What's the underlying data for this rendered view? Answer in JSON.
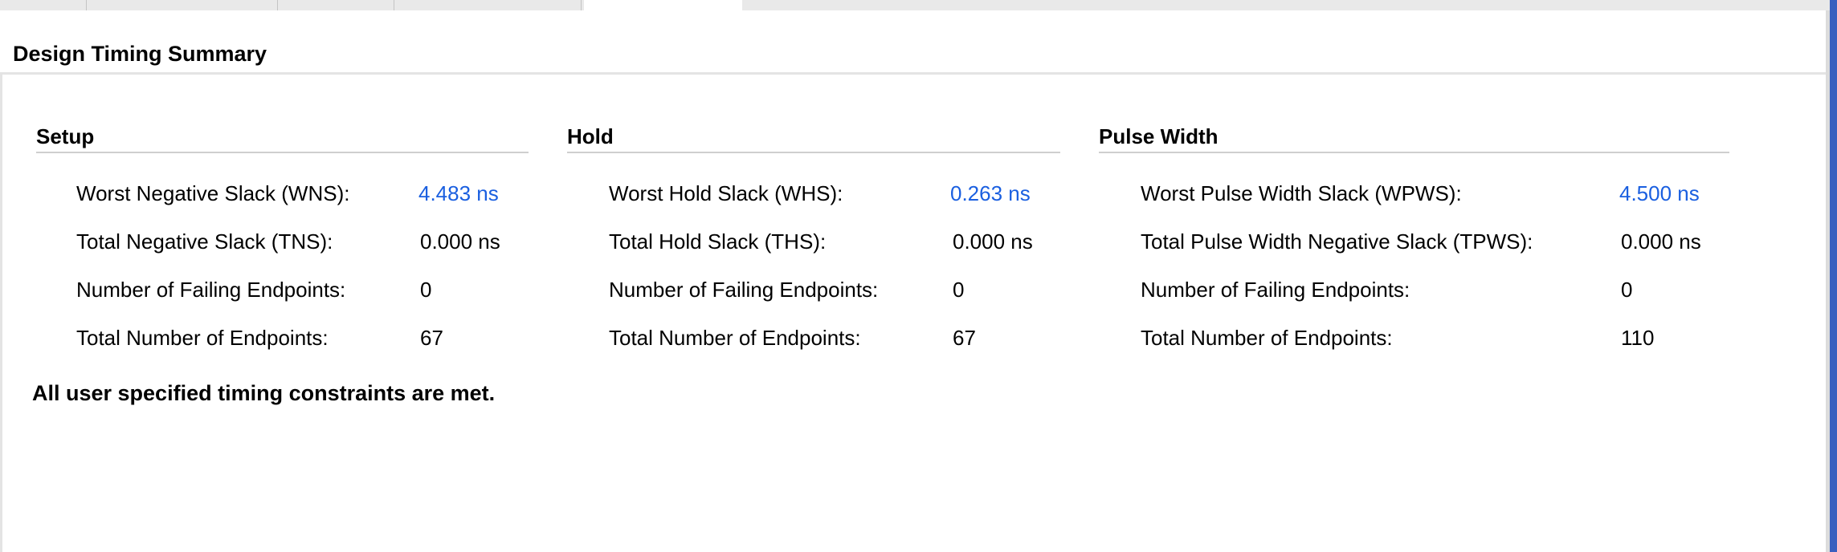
{
  "header": {
    "title": "Design Timing Summary"
  },
  "setup": {
    "title": "Setup",
    "rows": [
      {
        "label": "Worst Negative Slack (WNS):",
        "value": "4.483 ns"
      },
      {
        "label": "Total Negative Slack (TNS):",
        "value": "0.000 ns"
      },
      {
        "label": "Number of Failing Endpoints:",
        "value": "0"
      },
      {
        "label": "Total Number of Endpoints:",
        "value": "67"
      }
    ]
  },
  "hold": {
    "title": "Hold",
    "rows": [
      {
        "label": "Worst Hold Slack (WHS):",
        "value": "0.263 ns"
      },
      {
        "label": "Total Hold Slack (THS):",
        "value": "0.000 ns"
      },
      {
        "label": "Number of Failing Endpoints:",
        "value": "0"
      },
      {
        "label": "Total Number of Endpoints:",
        "value": "67"
      }
    ]
  },
  "pulse_width": {
    "title": "Pulse Width",
    "rows": [
      {
        "label": "Worst Pulse Width Slack (WPWS):",
        "value": "4.500 ns"
      },
      {
        "label": "Total Pulse Width Negative Slack (TPWS):",
        "value": "0.000 ns"
      },
      {
        "label": "Number of Failing Endpoints:",
        "value": "0"
      },
      {
        "label": "Total Number of Endpoints:",
        "value": "110"
      }
    ]
  },
  "status_message": "All user specified timing constraints are met.",
  "colors": {
    "link": "#1a5fe0",
    "window_border": "#3a5fbf"
  }
}
